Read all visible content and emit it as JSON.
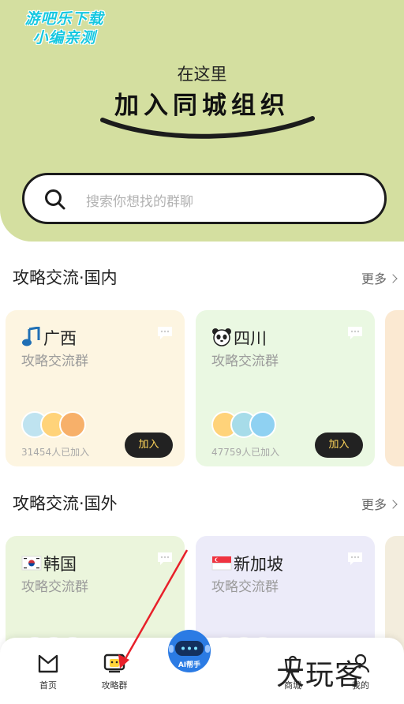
{
  "watermark": {
    "line1": "游吧乐下载",
    "line2": "小编亲测"
  },
  "hero": {
    "subtitle": "在这里",
    "title": "加入同城组织"
  },
  "search": {
    "placeholder": "搜索你想找的群聊"
  },
  "sections": [
    {
      "title": "攻略交流·国内",
      "more": "更多",
      "cards": [
        {
          "name": "广西",
          "emoji": "music-note-icon",
          "subtitle": "攻略交流群",
          "members": "31454人已加入",
          "join": "加入",
          "bg": "#fdf5e1"
        },
        {
          "name": "四川",
          "emoji": "panda-icon",
          "subtitle": "攻略交流群",
          "members": "47759人已加入",
          "join": "加入",
          "bg": "#eaf8e2"
        }
      ]
    },
    {
      "title": "攻略交流·国外",
      "more": "更多",
      "cards": [
        {
          "name": "韩国",
          "emoji": "korea-flag-icon",
          "subtitle": "攻略交流群",
          "bg": "#ebf5dc"
        },
        {
          "name": "新加坡",
          "emoji": "singapore-flag-icon",
          "subtitle": "攻略交流群",
          "bg": "#ecebf9"
        }
      ]
    }
  ],
  "tabbar": {
    "tabs": [
      {
        "label": "首页",
        "icon": "home-icon"
      },
      {
        "label": "攻略群",
        "icon": "group-chat-icon"
      },
      {
        "label": "商城",
        "icon": "shop-icon"
      },
      {
        "label": "我的",
        "icon": "profile-icon"
      }
    ],
    "ai_label": "AI帮手",
    "ghost_join": "加入"
  },
  "overlay_watermark": "大玩客",
  "colors": {
    "hero_bg": "#d4dfa0",
    "join_text": "#ffd65a",
    "arrow": "#e8202a"
  }
}
